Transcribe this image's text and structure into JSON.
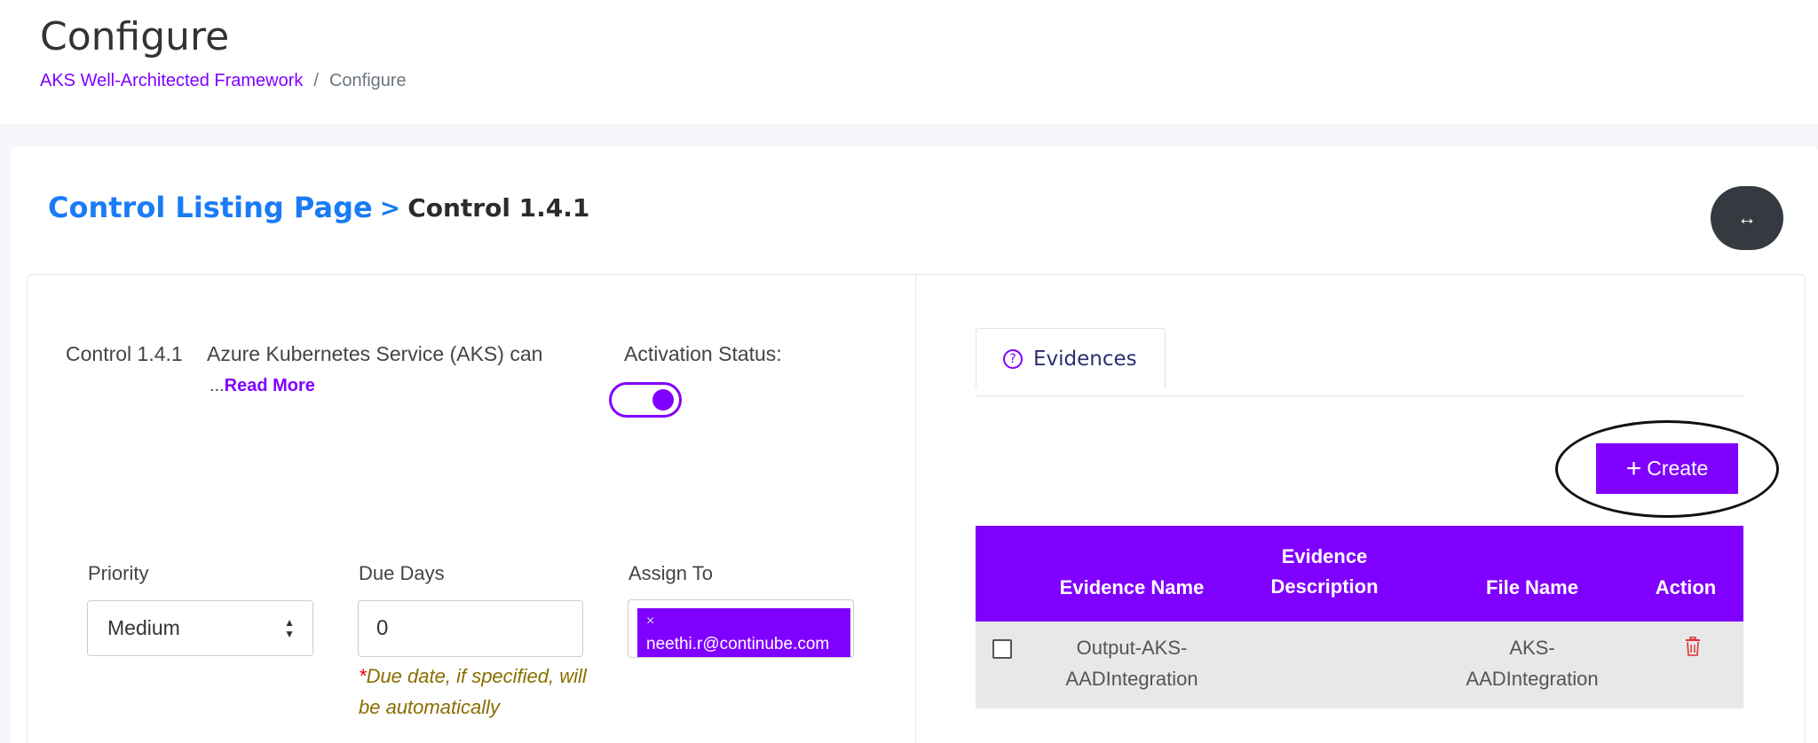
{
  "header": {
    "title": "Configure",
    "breadcrumb": {
      "link": "AKS Well-Architected Framework",
      "separator": "/",
      "current": "Configure"
    }
  },
  "card": {
    "heading_link": "Control Listing Page",
    "heading_arrow": ">",
    "heading_current": "Control 1.4.1",
    "expand_icon": "↔"
  },
  "control": {
    "id": "Control 1.4.1",
    "description": "Azure Kubernetes Service (AKS) can",
    "read_more_dots": "...",
    "read_more": "Read More",
    "activation_label": "Activation Status:",
    "activation_on": true
  },
  "form": {
    "priority_label": "Priority",
    "priority_value": "Medium",
    "due_days_label": "Due Days",
    "due_days_value": "0",
    "due_note_star": "*",
    "due_note": "Due date, if specified, will be automatically",
    "assign_label": "Assign To",
    "assignee_remove": "×",
    "assignee": "neethi.r@continube.com"
  },
  "evidences": {
    "tab_label": "Evidences",
    "tab_icon": "?",
    "create_plus": "+",
    "create_label": "Create",
    "columns": [
      "Evidence Name",
      "Evidence Description",
      "File Name",
      "Action"
    ],
    "rows": [
      {
        "name_line1": "Output-AKS-",
        "name_line2": "AADIntegration",
        "description": "",
        "file_line1": "AKS-",
        "file_line2": "AADIntegration"
      }
    ]
  },
  "colors": {
    "accent": "#8000ff",
    "link_blue": "#1a7cf5",
    "dark_button": "#343a40",
    "delete_red": "#e03131"
  }
}
